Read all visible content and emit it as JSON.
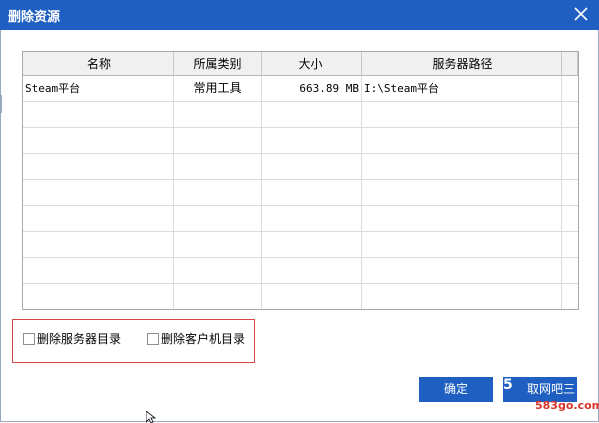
{
  "dialog": {
    "title": "删除资源"
  },
  "table": {
    "headers": [
      "名称",
      "所属类别",
      "大小",
      "服务器路径"
    ],
    "rows": [
      {
        "name": "Steam平台",
        "category": "常用工具",
        "size": "663.89 MB",
        "path": "I:\\Steam平台"
      }
    ]
  },
  "options": {
    "delete_server_dir": {
      "label": "删除服务器目录",
      "checked": false
    },
    "delete_client_dir": {
      "label": "删除客户机目录",
      "checked": false
    }
  },
  "buttons": {
    "confirm": "确定",
    "cancel_overlay": "取网吧三"
  },
  "watermark": {
    "logo": "5",
    "url": "583go.com"
  },
  "colors": {
    "title_bar": "#1e5fc1",
    "button": "#1e5fc1",
    "highlight_border": "#d94545",
    "watermark_url": "#d6352b"
  }
}
